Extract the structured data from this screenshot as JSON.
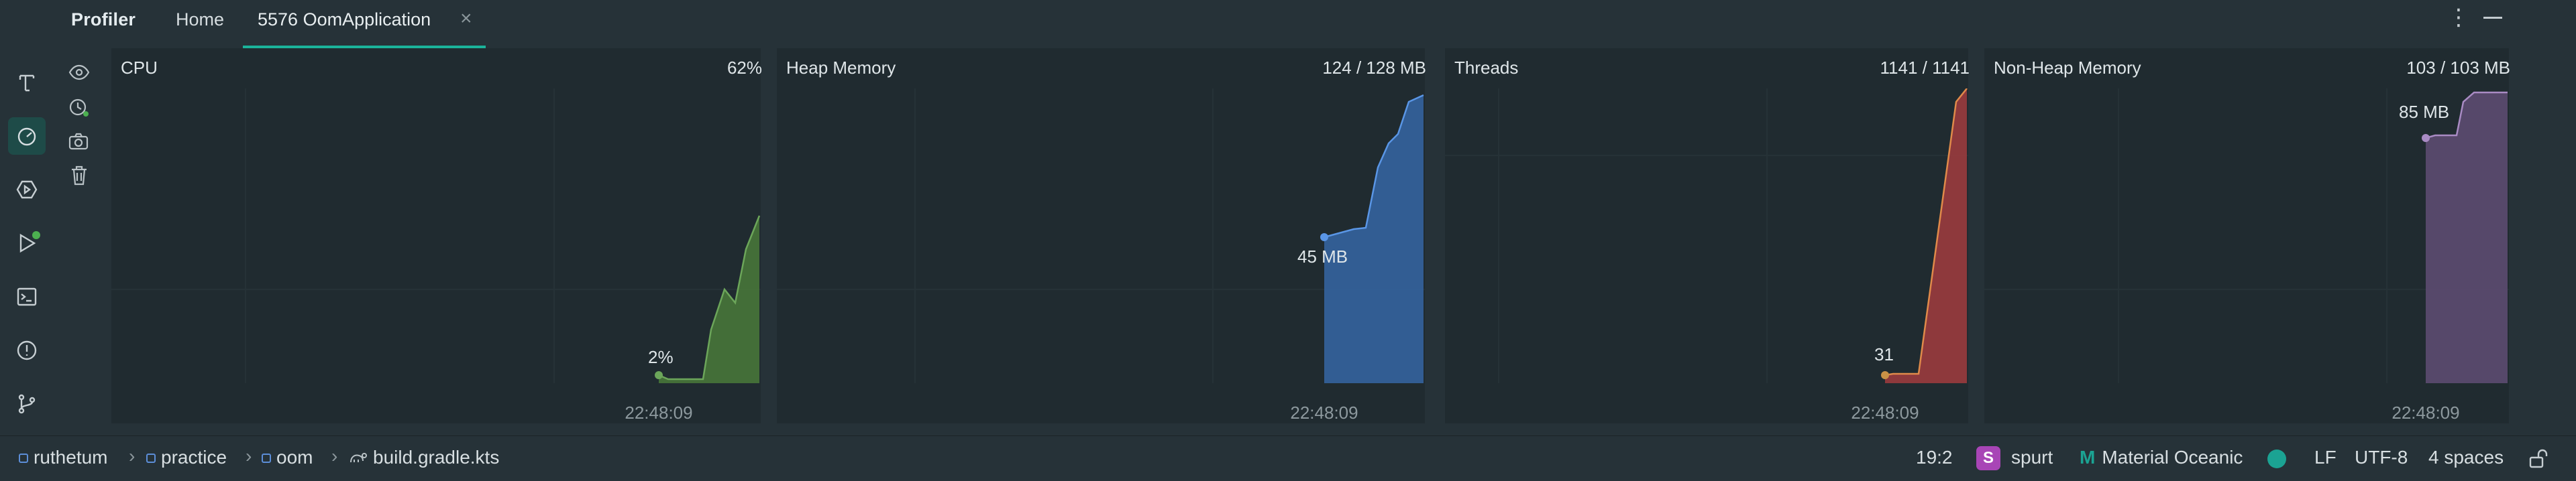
{
  "header": {
    "title": "Profiler",
    "tabs": [
      {
        "label": "Home"
      },
      {
        "label": "5576 OomApplication",
        "close": "×"
      }
    ],
    "menu_icon": "more-vertical-icon",
    "minimize_icon": "minimize-icon"
  },
  "left_rail": {
    "items": [
      {
        "name": "text-tool-icon"
      },
      {
        "name": "profiler-gauge-icon",
        "active": true
      },
      {
        "name": "services-icon"
      },
      {
        "name": "run-icon"
      },
      {
        "name": "terminal-icon"
      },
      {
        "name": "problems-icon"
      },
      {
        "name": "git-icon"
      }
    ]
  },
  "tool_column": {
    "items": [
      {
        "name": "eye-icon"
      },
      {
        "name": "snapshot-timer-icon"
      },
      {
        "name": "camera-icon"
      },
      {
        "name": "trash-icon"
      }
    ]
  },
  "panels": {
    "cpu": {
      "title": "CPU",
      "value": "62%",
      "start_label": "2%",
      "time": "22:48:09",
      "color": "#4a7a3a",
      "stroke": "#6ca65a"
    },
    "heap": {
      "title": "Heap Memory",
      "value": "124 / 128 MB",
      "start_label": "45 MB",
      "time": "22:48:09",
      "color": "#34639f",
      "stroke": "#5a96e6"
    },
    "threads": {
      "title": "Threads",
      "value": "1141 / 1141",
      "start_label": "31",
      "time": "22:48:09",
      "color": "#9a3b3e",
      "stroke": "#e08a4a"
    },
    "nonheap": {
      "title": "Non-Heap Memory",
      "value": "103 / 103 MB",
      "start_label": "85 MB",
      "time": "22:48:09",
      "color": "#5a4a6e",
      "stroke": "#a98bc4"
    }
  },
  "status_bar": {
    "breadcrumbs": [
      "ruthetum",
      "practice",
      "oom",
      "build.gradle.kts"
    ],
    "position": "19:2",
    "vcs_badge": "S",
    "vcs_name": "spurt",
    "theme": "Material Oceanic",
    "line_ending": "LF",
    "encoding": "UTF-8",
    "indent": "4 spaces"
  }
}
